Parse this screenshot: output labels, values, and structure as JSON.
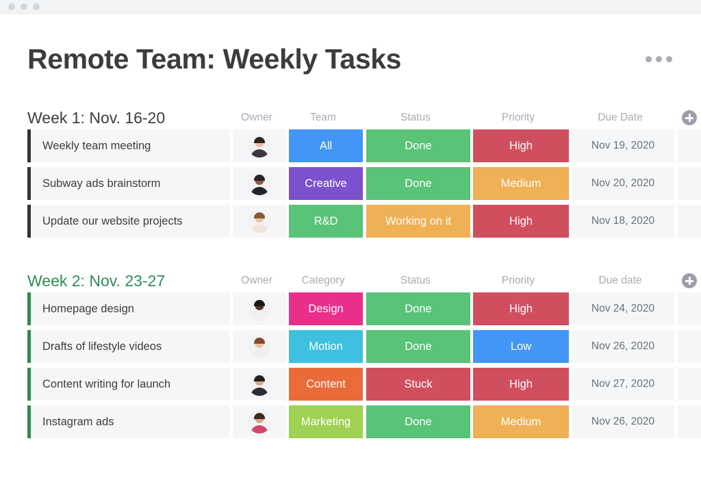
{
  "window": {
    "dots": [
      "dot-1",
      "dot-2",
      "dot-3"
    ]
  },
  "header": {
    "title": "Remote Team: Weekly Tasks",
    "menu_icon": "kebab-menu-icon"
  },
  "colors": {
    "green": "#59c378",
    "red": "#d04f5f",
    "orange": "#f0b055",
    "blue": "#4396f5",
    "purple": "#7b51ce",
    "pink": "#e8308a",
    "cyan": "#3ec1e0",
    "orange_red": "#ea6b3a",
    "lime": "#9fd153",
    "group2_heading": "#2e8b57",
    "group1_bar": "#333333",
    "group2_bar": "#2e8b4f",
    "cell_bg": "#f5f6f7",
    "header_text": "#a8abb3"
  },
  "groups": [
    {
      "title": "Week 1: Nov. 16-20",
      "title_color": "dark",
      "bar_color": "dark",
      "columns": {
        "owner": "Owner",
        "category": "Team",
        "status": "Status",
        "priority": "Priority",
        "date": "Due Date"
      },
      "add_column_icon": "plus-circle-icon",
      "rows": [
        {
          "name": "Weekly team meeting",
          "owner_avatar": "avatar-person-1",
          "category": {
            "label": "All",
            "color": "#4396f5"
          },
          "status": {
            "label": "Done",
            "color": "#59c378"
          },
          "priority": {
            "label": "High",
            "color": "#d04f5f"
          },
          "date": "Nov 19, 2020"
        },
        {
          "name": "Subway ads brainstorm",
          "owner_avatar": "avatar-person-2",
          "category": {
            "label": "Creative",
            "color": "#7b51ce"
          },
          "status": {
            "label": "Done",
            "color": "#59c378"
          },
          "priority": {
            "label": "Medium",
            "color": "#f0b055"
          },
          "date": "Nov 20, 2020"
        },
        {
          "name": "Update our website projects",
          "owner_avatar": "avatar-person-3",
          "category": {
            "label": "R&D",
            "color": "#59c378"
          },
          "status": {
            "label": "Working on it",
            "color": "#f0b055"
          },
          "priority": {
            "label": "High",
            "color": "#d04f5f"
          },
          "date": "Nov 18, 2020"
        }
      ]
    },
    {
      "title": "Week 2: Nov. 23-27",
      "title_color": "green",
      "bar_color": "green",
      "columns": {
        "owner": "Owner",
        "category": "Category",
        "status": "Status",
        "priority": "Priority",
        "date": "Due date"
      },
      "add_column_icon": "plus-circle-icon",
      "rows": [
        {
          "name": "Homepage design",
          "owner_avatar": "avatar-person-4",
          "category": {
            "label": "Design",
            "color": "#e8308a"
          },
          "status": {
            "label": "Done",
            "color": "#59c378"
          },
          "priority": {
            "label": "High",
            "color": "#d04f5f"
          },
          "date": "Nov 24, 2020"
        },
        {
          "name": "Drafts of lifestyle videos",
          "owner_avatar": "avatar-person-5",
          "category": {
            "label": "Motion",
            "color": "#3ec1e0"
          },
          "status": {
            "label": "Done",
            "color": "#59c378"
          },
          "priority": {
            "label": "Low",
            "color": "#4396f5"
          },
          "date": "Nov 26, 2020"
        },
        {
          "name": "Content writing for launch",
          "owner_avatar": "avatar-person-6",
          "category": {
            "label": "Content",
            "color": "#ea6b3a"
          },
          "status": {
            "label": "Stuck",
            "color": "#d04f5f"
          },
          "priority": {
            "label": "High",
            "color": "#d04f5f"
          },
          "date": "Nov 27, 2020"
        },
        {
          "name": "Instagram ads",
          "owner_avatar": "avatar-person-7",
          "category": {
            "label": "Marketing",
            "color": "#9fd153"
          },
          "status": {
            "label": "Done",
            "color": "#59c378"
          },
          "priority": {
            "label": "Medium",
            "color": "#f0b055"
          },
          "date": "Nov 26, 2020"
        }
      ]
    }
  ],
  "avatar_palette": {
    "avatar-person-1": {
      "skin": "#e8c0a8",
      "hair": "#2c2622",
      "body": "#3a3a40"
    },
    "avatar-person-2": {
      "skin": "#8d5a3b",
      "hair": "#2b2320",
      "body": "#23242a"
    },
    "avatar-person-3": {
      "skin": "#ecc3a4",
      "hair": "#8a5a30",
      "body": "#efe4d6"
    },
    "avatar-person-4": {
      "skin": "#5b3724",
      "hair": "#1d1713",
      "body": "#f0f0f2"
    },
    "avatar-person-5": {
      "skin": "#ebc3a5",
      "hair": "#8c4a2c",
      "body": "#eeeef0"
    },
    "avatar-person-6": {
      "skin": "#d9a97f",
      "hair": "#23201e",
      "body": "#2e2c30"
    },
    "avatar-person-7": {
      "skin": "#d9a87e",
      "hair": "#3a2a20",
      "body": "#d4476f"
    }
  }
}
